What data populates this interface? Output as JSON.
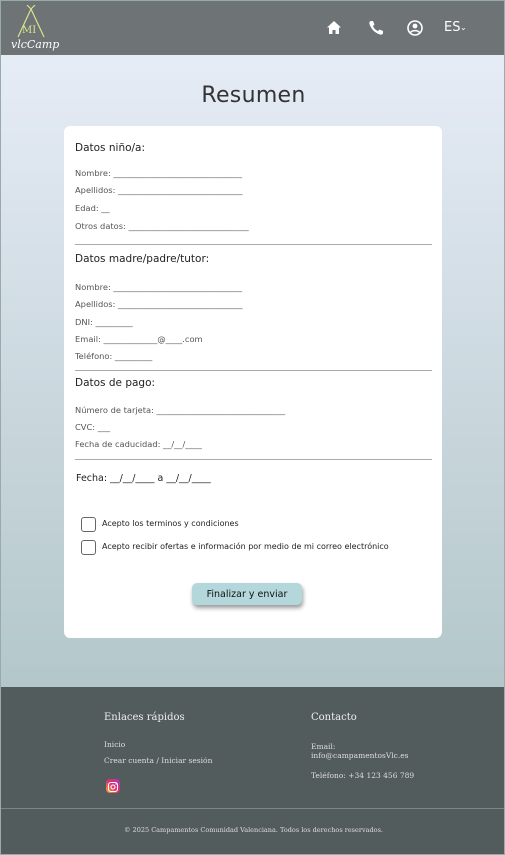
{
  "header": {
    "logo_mi": "MI",
    "logo_text": "vlcCamp",
    "language": "ES",
    "icons": [
      "home-icon",
      "phone-icon",
      "user-icon",
      "chevron-down-icon"
    ]
  },
  "main": {
    "title": "Resumen",
    "child": {
      "heading": "Datos niño/a:",
      "fields": [
        "Nombre: _______________________________",
        "Apellidos: ______________________________",
        "Edad: __",
        "Otros datos: _____________________________"
      ]
    },
    "parent": {
      "heading": "Datos madre/padre/tutor:",
      "fields": [
        "Nombre: _______________________________",
        "Apellidos: ______________________________",
        "DNI: _________",
        "Email: _____________@____.com",
        "Teléfono: _________"
      ]
    },
    "payment": {
      "heading": "Datos de pago:",
      "fields": [
        "Número de tarjeta: _______________________________",
        "CVC: ___",
        "Fecha de caducidad: __/__/____"
      ]
    },
    "date_line": "Fecha: __/__/____ a __/__/____",
    "checkboxes": [
      "Acepto los terminos y condiciones",
      "Acepto recibir ofertas e información por medio de mi correo electrónico"
    ],
    "submit_label": "Finalizar y enviar"
  },
  "footer": {
    "quick_links_heading": "Enlaces rápidos",
    "links": [
      "Inicio",
      "Crear cuenta / Iniciar sesión"
    ],
    "contact_heading": "Contacto",
    "email_label": "Email:",
    "email": "info@campamentosVlc.es",
    "phone": "Teléfono: +34 123 456 789",
    "copyright": "© 2025 Campamentos Comunidad Valenciana. Todos los derechos reservados."
  }
}
